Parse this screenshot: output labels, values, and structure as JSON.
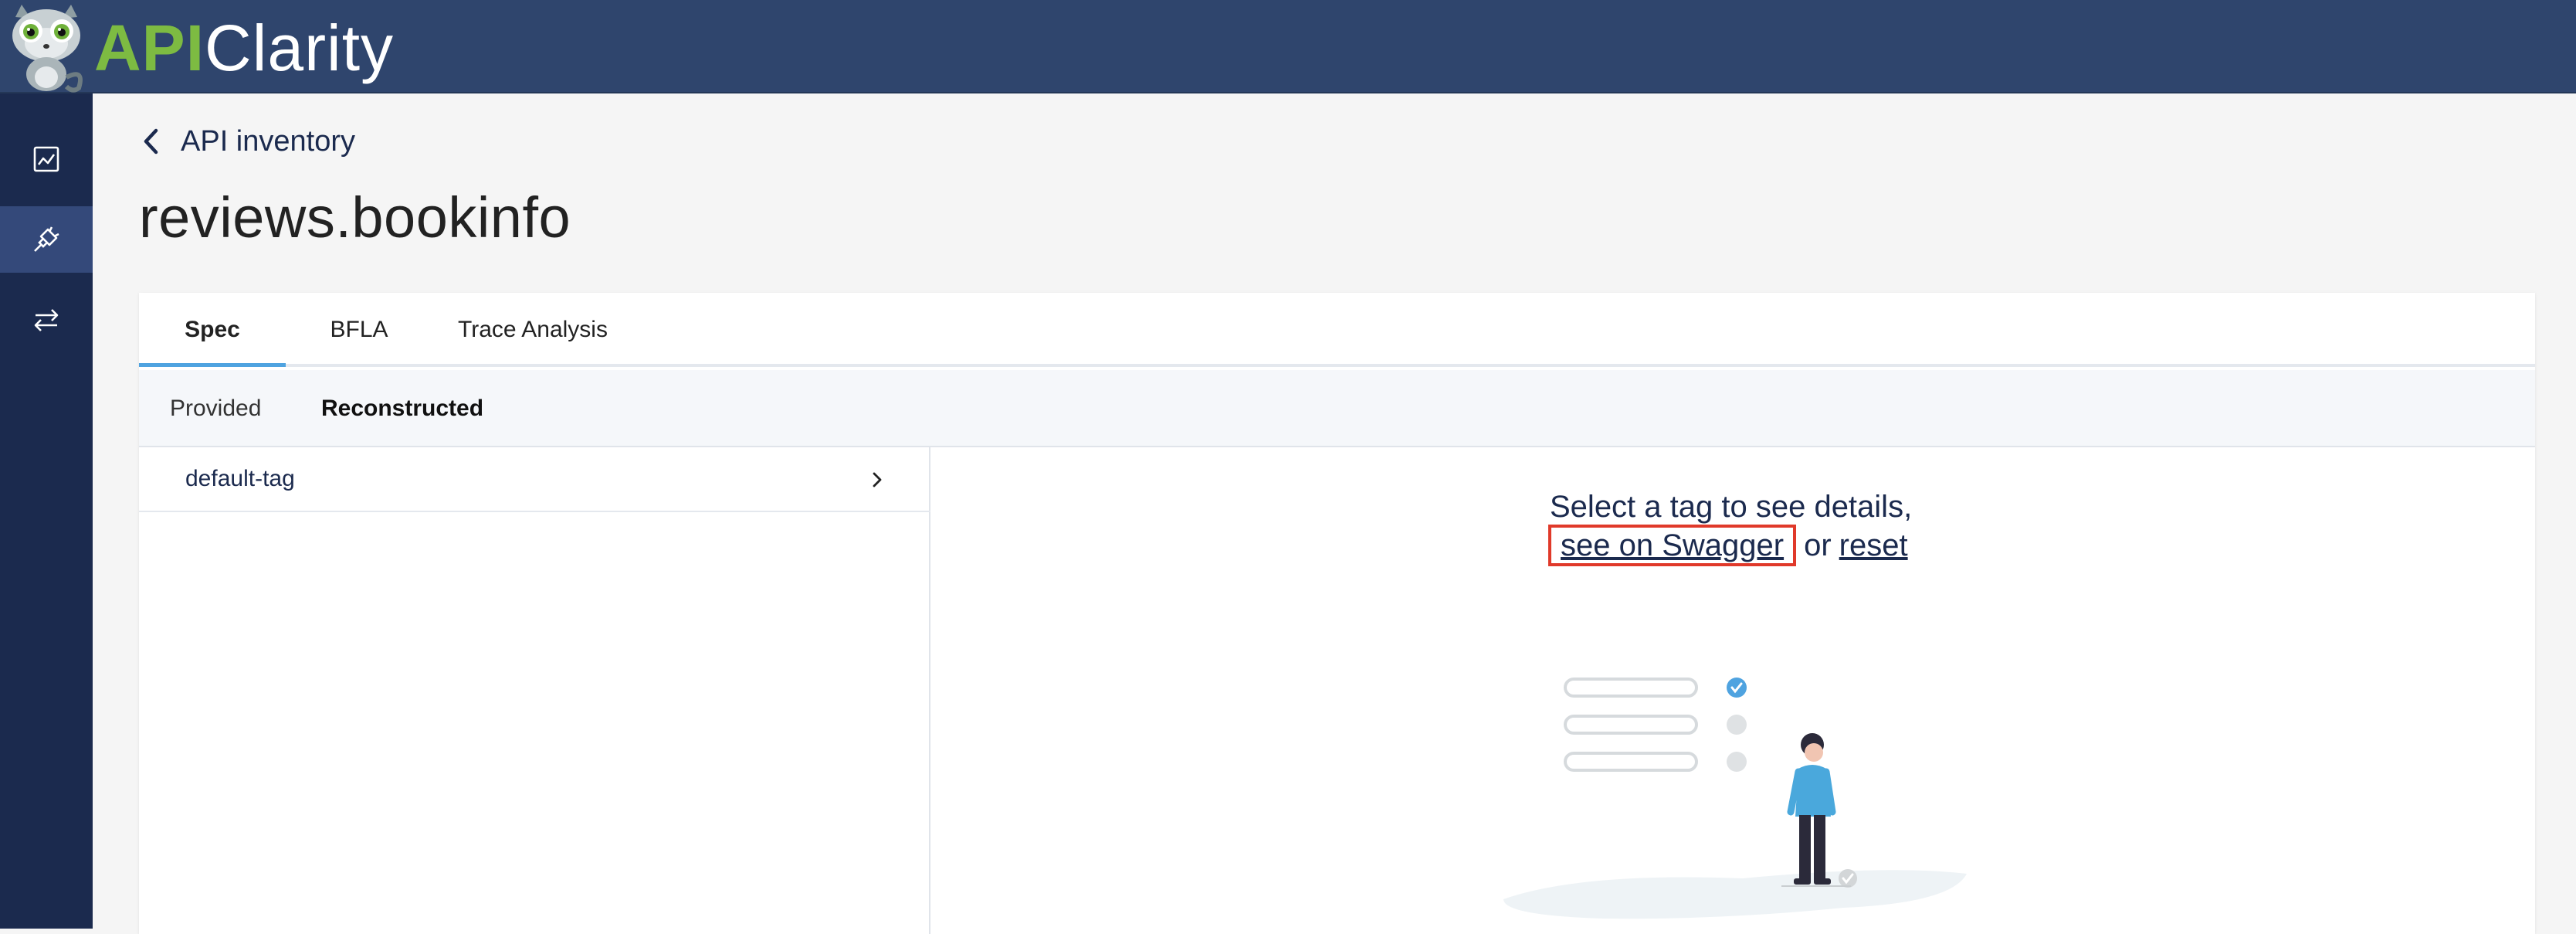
{
  "app": {
    "logo_api": "API",
    "logo_clarity": "Clarity",
    "brand_color": "#2f456d",
    "accent_green": "#7dbb42"
  },
  "sidebar": {
    "items": [
      {
        "icon": "dashboard-chart-icon",
        "active": false
      },
      {
        "icon": "api-plug-icon",
        "active": true
      },
      {
        "icon": "events-arrows-icon",
        "active": false
      }
    ]
  },
  "breadcrumb": {
    "back_label": "API inventory"
  },
  "page": {
    "title": "reviews.bookinfo"
  },
  "tabs": [
    {
      "label": "Spec",
      "active": true
    },
    {
      "label": "BFLA",
      "active": false
    },
    {
      "label": "Trace Analysis",
      "active": false
    }
  ],
  "subtabs": [
    {
      "label": "Provided",
      "active": false
    },
    {
      "label": "Reconstructed",
      "active": true
    }
  ],
  "tags": [
    {
      "label": "default-tag"
    }
  ],
  "empty_state": {
    "line1": "Select a tag to see details,",
    "swagger_link": "see on Swagger",
    "or_text": "or",
    "reset_link": "reset"
  },
  "colors": {
    "tab_indicator": "#4fa3e0",
    "highlight_box": "#e0392a",
    "sidebar_bg": "#1b2a4e"
  }
}
